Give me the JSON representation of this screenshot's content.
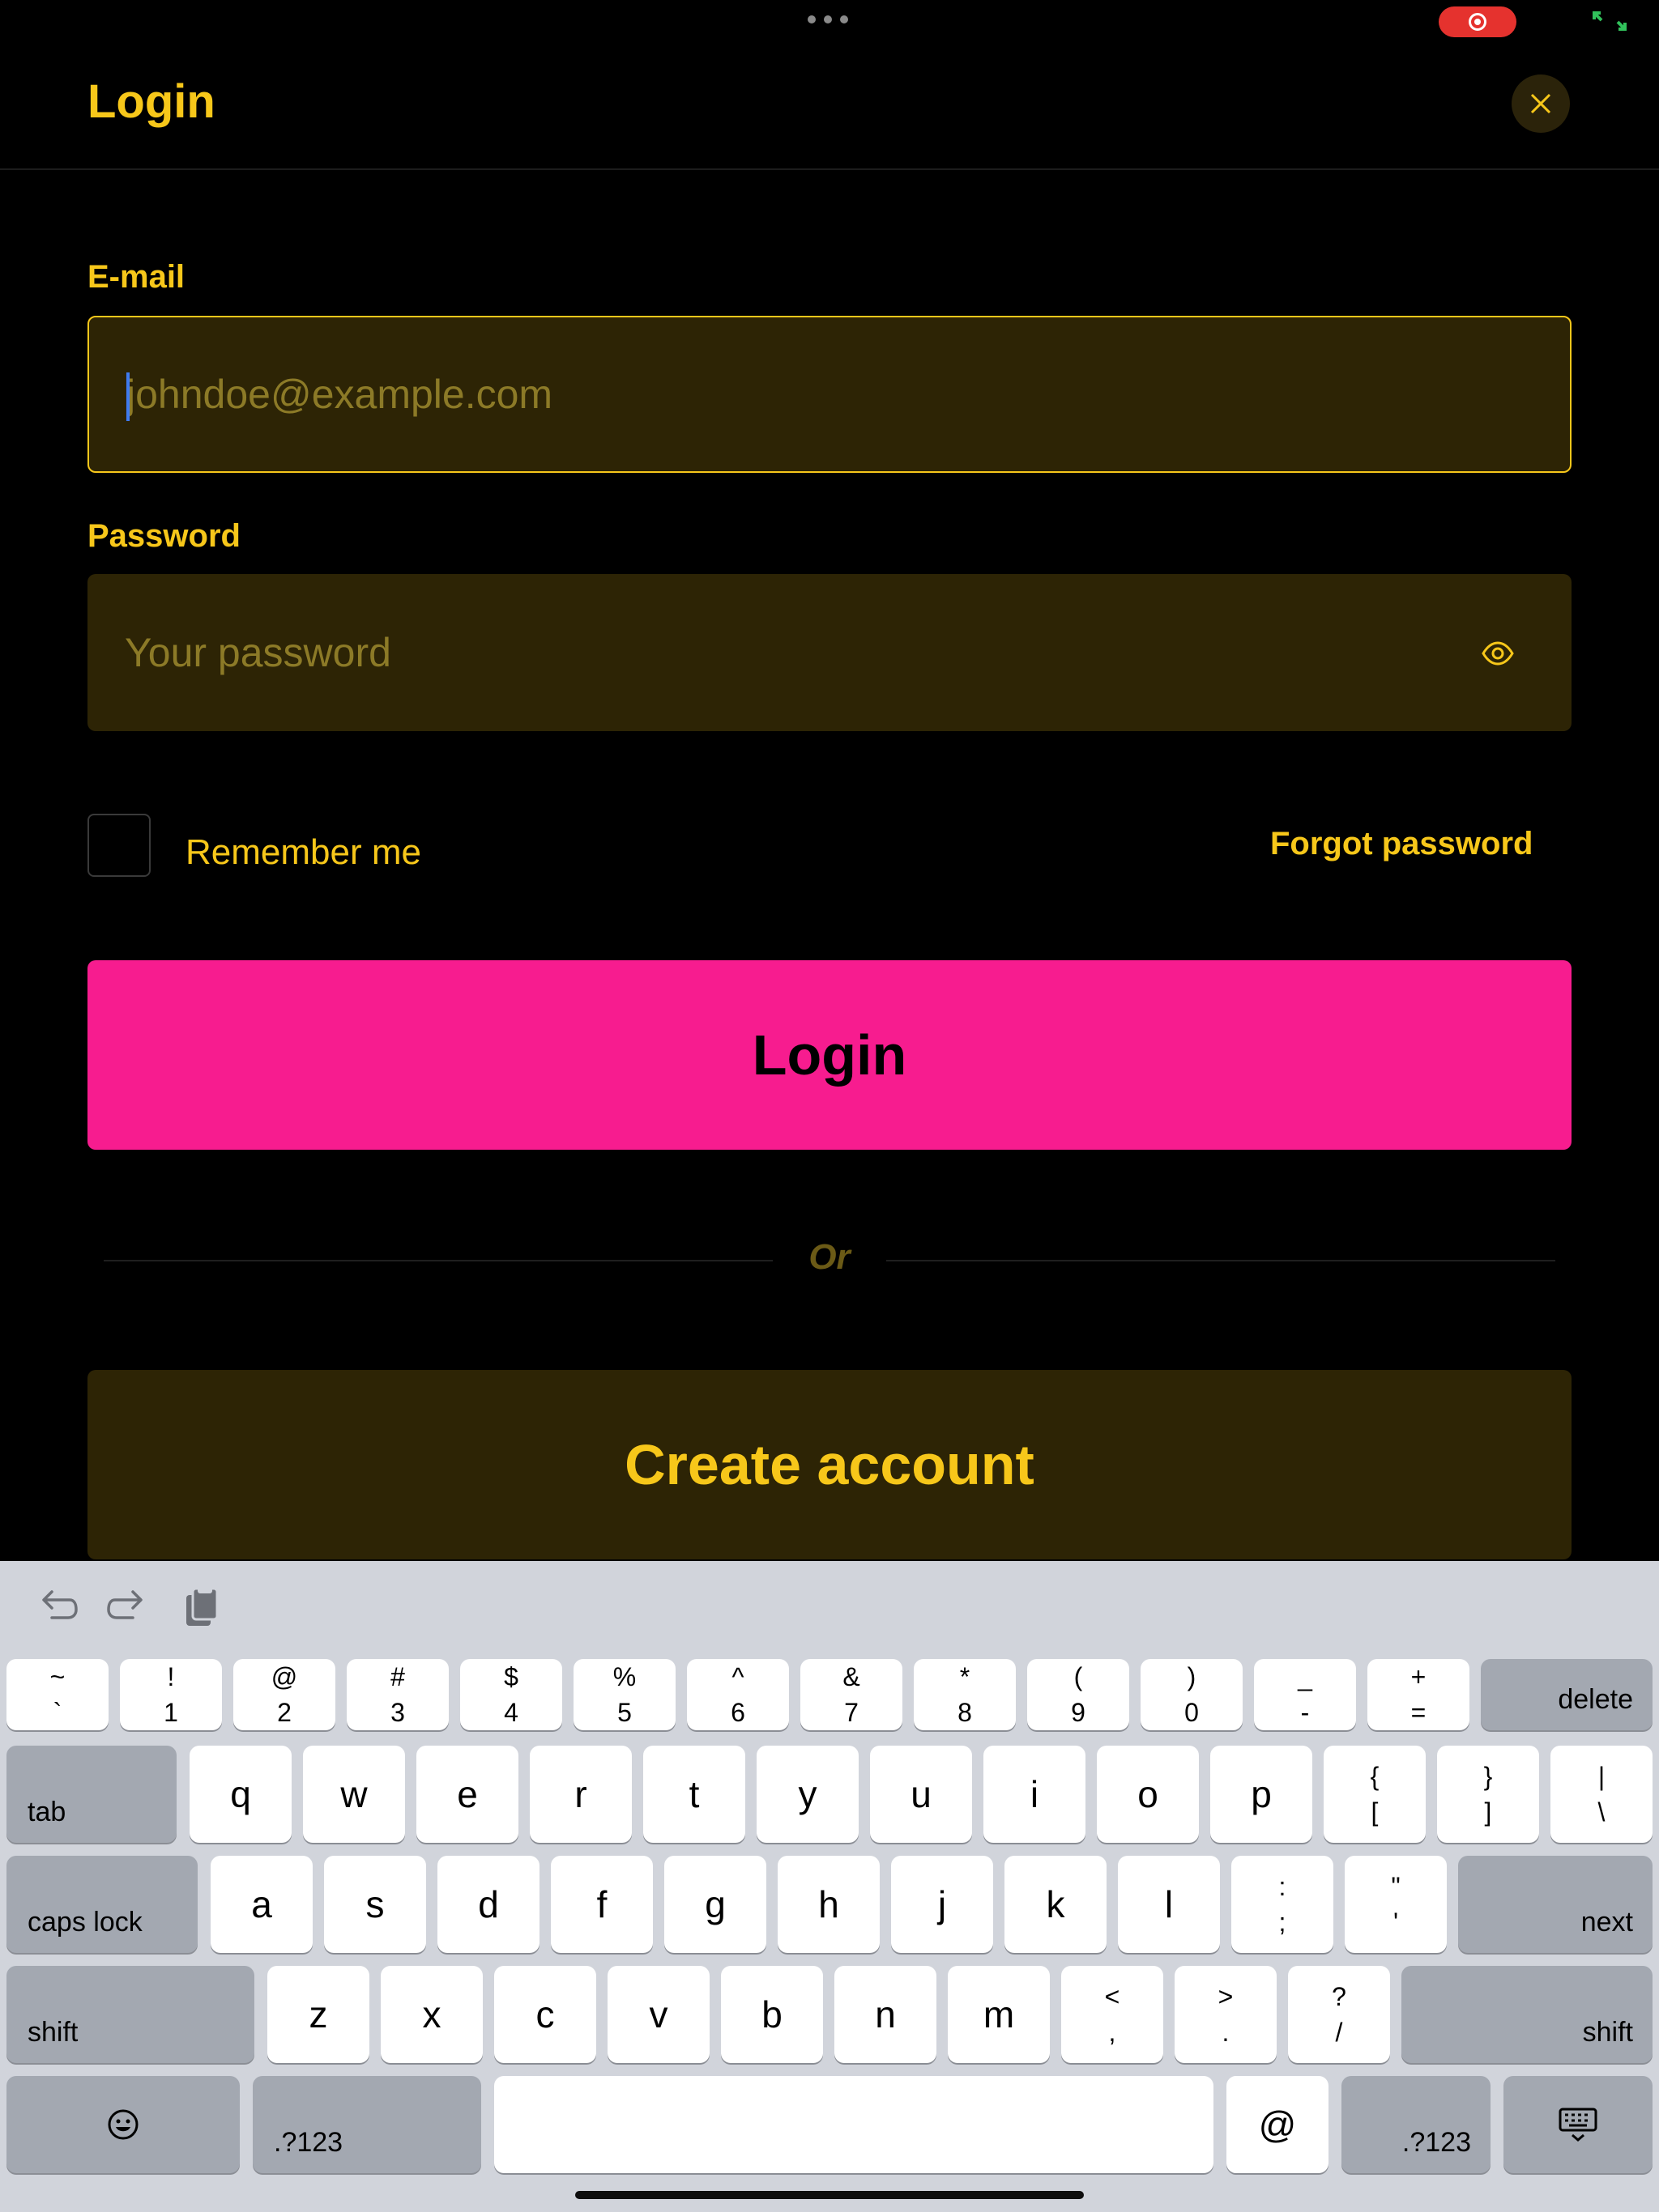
{
  "status": {
    "more_icon": "ellipsis-icon",
    "record_icon": "screen-record-icon",
    "fullscreen_icon": "fullscreen-icon"
  },
  "header": {
    "title": "Login",
    "close_icon": "close-icon"
  },
  "email": {
    "label": "E-mail",
    "placeholder": "johndoe@example.com",
    "value": ""
  },
  "password": {
    "label": "Password",
    "placeholder": "Your password",
    "value": "",
    "toggle_icon": "eye-icon"
  },
  "remember": {
    "label": "Remember me",
    "checked": false
  },
  "forgot": {
    "label": "Forgot password"
  },
  "login_button": {
    "label": "Login"
  },
  "divider": {
    "text": "Or"
  },
  "create_button": {
    "label": "Create account"
  },
  "colors": {
    "accent": "#f7c71a",
    "primary": "#f71c8f",
    "field_bg": "#2d2405",
    "background": "#000000"
  },
  "keyboard": {
    "toolbar": [
      "undo-icon",
      "redo-icon",
      "clipboard-icon"
    ],
    "row1": [
      [
        "~",
        "`"
      ],
      [
        "!",
        "1"
      ],
      [
        "@",
        "2"
      ],
      [
        "#",
        "3"
      ],
      [
        "$",
        "4"
      ],
      [
        "%",
        "5"
      ],
      [
        "^",
        "6"
      ],
      [
        "&",
        "7"
      ],
      [
        "*",
        "8"
      ],
      [
        "(",
        "9"
      ],
      [
        ")",
        "0"
      ],
      [
        "_",
        "-"
      ],
      [
        "+",
        "="
      ]
    ],
    "delete": "delete",
    "tab": "tab",
    "row2": [
      "q",
      "w",
      "e",
      "r",
      "t",
      "y",
      "u",
      "i",
      "o",
      "p"
    ],
    "row2_sym": [
      [
        "{",
        "["
      ],
      [
        "}",
        "]"
      ],
      [
        "|",
        "\\"
      ]
    ],
    "caps": "caps lock",
    "row3": [
      "a",
      "s",
      "d",
      "f",
      "g",
      "h",
      "j",
      "k",
      "l"
    ],
    "row3_sym": [
      [
        ":",
        ";"
      ],
      [
        "\"",
        "'"
      ]
    ],
    "next": "next",
    "shift": "shift",
    "row4": [
      "z",
      "x",
      "c",
      "v",
      "b",
      "n",
      "m"
    ],
    "row4_sym": [
      [
        "<",
        ","
      ],
      [
        ">",
        "."
      ],
      [
        "?",
        "/"
      ]
    ],
    "emoji_icon": "emoji-icon",
    "numbers": ".?123",
    "at": "@",
    "dismiss_icon": "keyboard-dismiss-icon"
  }
}
